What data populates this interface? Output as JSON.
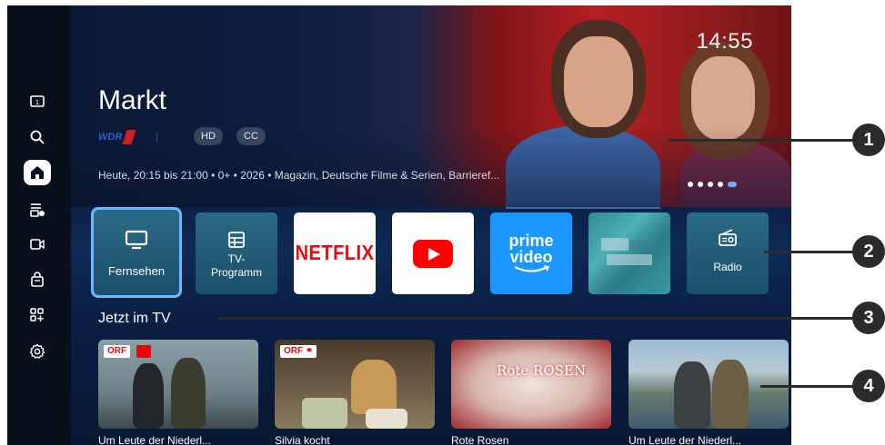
{
  "hero": {
    "title": "Markt",
    "clock": "14:55",
    "channel_logo": "WDR",
    "badges": [
      "HD",
      "CC"
    ],
    "info": "Heute, 20:15 bis 21:00 • 0+ • 2026 • Magazin, Deutsche Filme & Serien, Barrieref...",
    "carousel": {
      "count": 5,
      "active_index": 4
    }
  },
  "sidebar": {
    "items": [
      {
        "icon": "input-source-icon",
        "label": "Input"
      },
      {
        "icon": "search-icon",
        "label": "Search"
      },
      {
        "icon": "home-icon",
        "label": "Home",
        "active": true
      },
      {
        "icon": "guide-icon",
        "label": "Guide"
      },
      {
        "icon": "recording-icon",
        "label": "Recordings"
      },
      {
        "icon": "store-icon",
        "label": "Store"
      },
      {
        "icon": "add-apps-icon",
        "label": "Apps"
      },
      {
        "icon": "settings-icon",
        "label": "Settings"
      }
    ]
  },
  "apps": [
    {
      "name": "Fernsehen",
      "icon": "tv-icon",
      "selected": true
    },
    {
      "name": "TV-\nProgramm",
      "icon": "program-guide-icon"
    },
    {
      "name": "NETFLIX",
      "icon": "netflix-logo"
    },
    {
      "name": "YouTube",
      "icon": "youtube-logo"
    },
    {
      "name": "prime video",
      "icon": "prime-video-logo"
    },
    {
      "name": "",
      "icon": "blurred-app-icon"
    },
    {
      "name": "Radio",
      "icon": "radio-icon"
    }
  ],
  "section": {
    "title": "Jetzt im TV",
    "thumbs": [
      {
        "channel": "ORF",
        "label": "Um Leute der Niederl..."
      },
      {
        "channel": "ORF ⚭",
        "label": "Silvia kocht"
      },
      {
        "overlay": "Rote ROSEN",
        "label": "Rote Rosen"
      },
      {
        "label": "Um Leute der Niederl..."
      }
    ]
  },
  "callouts": [
    "1",
    "2",
    "3",
    "4"
  ],
  "colors": {
    "accent": "#6cb8ff",
    "netflix": "#e50914",
    "youtube": "#ff0000",
    "prime": "#1a98ff"
  }
}
